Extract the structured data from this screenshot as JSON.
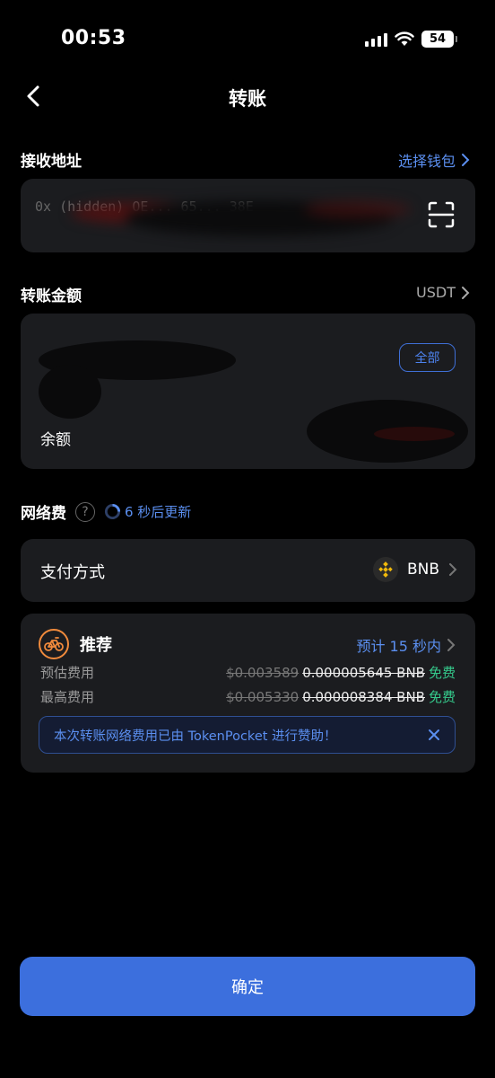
{
  "status_bar": {
    "time": "00:53",
    "battery": "54"
  },
  "header": {
    "title": "转账"
  },
  "receive": {
    "label": "接收地址",
    "link": "选择钱包",
    "address_fragment": "0x (hidden) OE... 65... 38E"
  },
  "amount": {
    "label": "转账金额",
    "token": "USDT",
    "max_label": "全部",
    "balance_label": "余额"
  },
  "network_fee": {
    "label": "网络费",
    "help": "?",
    "refresh_text": "6 秒后更新"
  },
  "payment": {
    "label": "支付方式",
    "value": "BNB"
  },
  "speed": {
    "title": "推荐",
    "eta": "预计 15 秒内",
    "estimated": {
      "label": "预估费用",
      "usd": "$0.003589",
      "bnb": "0.000005645 BNB",
      "free": "免费"
    },
    "maximum": {
      "label": "最高费用",
      "usd": "$0.005330",
      "bnb": "0.000008384 BNB",
      "free": "免费"
    },
    "sponsor_text": "本次转账网络费用已由 TokenPocket 进行赞助！"
  },
  "confirm_label": "确定",
  "colors": {
    "accent": "#3c6fdd",
    "link": "#5b8ff0",
    "free": "#35c98b",
    "speed_icon": "#f08a3c",
    "background": "#000000",
    "card": "#1b1c1f"
  }
}
